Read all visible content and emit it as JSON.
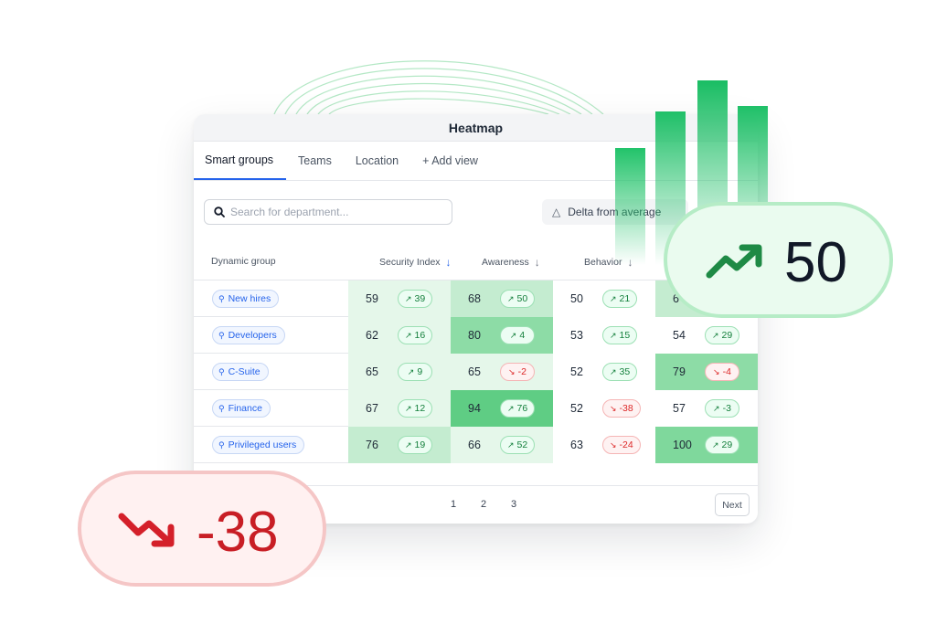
{
  "window": {
    "title": "Heatmap"
  },
  "tabs": [
    {
      "label": "Smart groups",
      "active": true
    },
    {
      "label": "Teams"
    },
    {
      "label": "Location"
    },
    {
      "label": "+ Add view"
    }
  ],
  "search": {
    "placeholder": "Search for department...",
    "icon": "search-icon"
  },
  "delta_button": {
    "label": "Delta from average",
    "icon": "triangle-icon"
  },
  "table": {
    "group_header": "Dynamic group",
    "columns": [
      {
        "label": "Security Index",
        "sort_icon": "arrow-down-icon",
        "accent": "#2563eb"
      },
      {
        "label": "Awareness",
        "sort_icon": "arrow-down-icon"
      },
      {
        "label": "Behavior",
        "sort_icon": "arrow-down-icon"
      },
      {
        "label": ""
      }
    ],
    "rows": [
      {
        "group": "New hires",
        "cells": [
          {
            "value": "59",
            "delta": "39",
            "dir": "up"
          },
          {
            "value": "68",
            "delta": "50",
            "dir": "up"
          },
          {
            "value": "50",
            "delta": "21",
            "dir": "up"
          },
          {
            "value": "6",
            "delta": "",
            "dir": "up"
          }
        ]
      },
      {
        "group": "Developers",
        "cells": [
          {
            "value": "62",
            "delta": "16",
            "dir": "up"
          },
          {
            "value": "80",
            "delta": "4",
            "dir": "up"
          },
          {
            "value": "53",
            "delta": "15",
            "dir": "up"
          },
          {
            "value": "54",
            "delta": "29",
            "dir": "up"
          }
        ]
      },
      {
        "group": "C-Suite",
        "cells": [
          {
            "value": "65",
            "delta": "9",
            "dir": "up"
          },
          {
            "value": "65",
            "delta": "-2",
            "dir": "down"
          },
          {
            "value": "52",
            "delta": "35",
            "dir": "up"
          },
          {
            "value": "79",
            "delta": "-4",
            "dir": "down"
          }
        ]
      },
      {
        "group": "Finance",
        "cells": [
          {
            "value": "67",
            "delta": "12",
            "dir": "up"
          },
          {
            "value": "94",
            "delta": "76",
            "dir": "up"
          },
          {
            "value": "52",
            "delta": "-38",
            "dir": "down"
          },
          {
            "value": "57",
            "delta": "-3",
            "dir": "up"
          }
        ]
      },
      {
        "group": "Privileged users",
        "cells": [
          {
            "value": "76",
            "delta": "19",
            "dir": "up"
          },
          {
            "value": "66",
            "delta": "52",
            "dir": "up"
          },
          {
            "value": "63",
            "delta": "-24",
            "dir": "down"
          },
          {
            "value": "100",
            "delta": "29",
            "dir": "up"
          }
        ]
      }
    ]
  },
  "pagination": {
    "pages": [
      "1",
      "2",
      "3"
    ],
    "next": "Next"
  },
  "callouts": {
    "up": {
      "value": "50",
      "icon": "trending-up-icon",
      "color": "#1e8a45"
    },
    "down": {
      "value": "-38",
      "icon": "trending-down-icon",
      "color": "#d4202a"
    }
  },
  "colors": {
    "heat_light": "#e5f7ea",
    "heat_mid": "#c4ecd0",
    "heat_strong": "#8ddca6",
    "positive": "#15803d",
    "negative": "#dc2626",
    "link": "#2563eb",
    "bar_green": "#22c36a"
  }
}
